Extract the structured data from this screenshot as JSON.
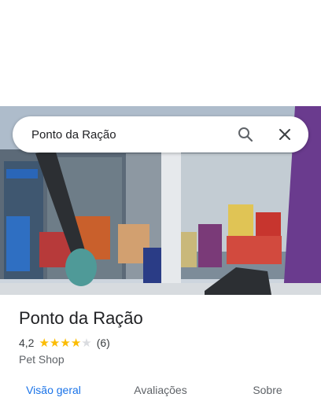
{
  "search": {
    "query": "Ponto da Ração"
  },
  "icons": {
    "search": "search-icon",
    "close": "close-icon",
    "star": "star-icon"
  },
  "place": {
    "name": "Ponto da Ração",
    "rating": "4,2",
    "rating_fraction": 0.84,
    "stars_filled": 4,
    "review_count": "(6)",
    "category": "Pet Shop"
  },
  "tabs": [
    {
      "label": "Visão geral",
      "active": true
    },
    {
      "label": "Avaliações",
      "active": false
    },
    {
      "label": "Sobre",
      "active": false
    }
  ],
  "colors": {
    "accent": "#1a73e8",
    "star": "#fbbc04",
    "star_empty": "#dadce0",
    "text": "#202124",
    "muted": "#5f6368"
  }
}
